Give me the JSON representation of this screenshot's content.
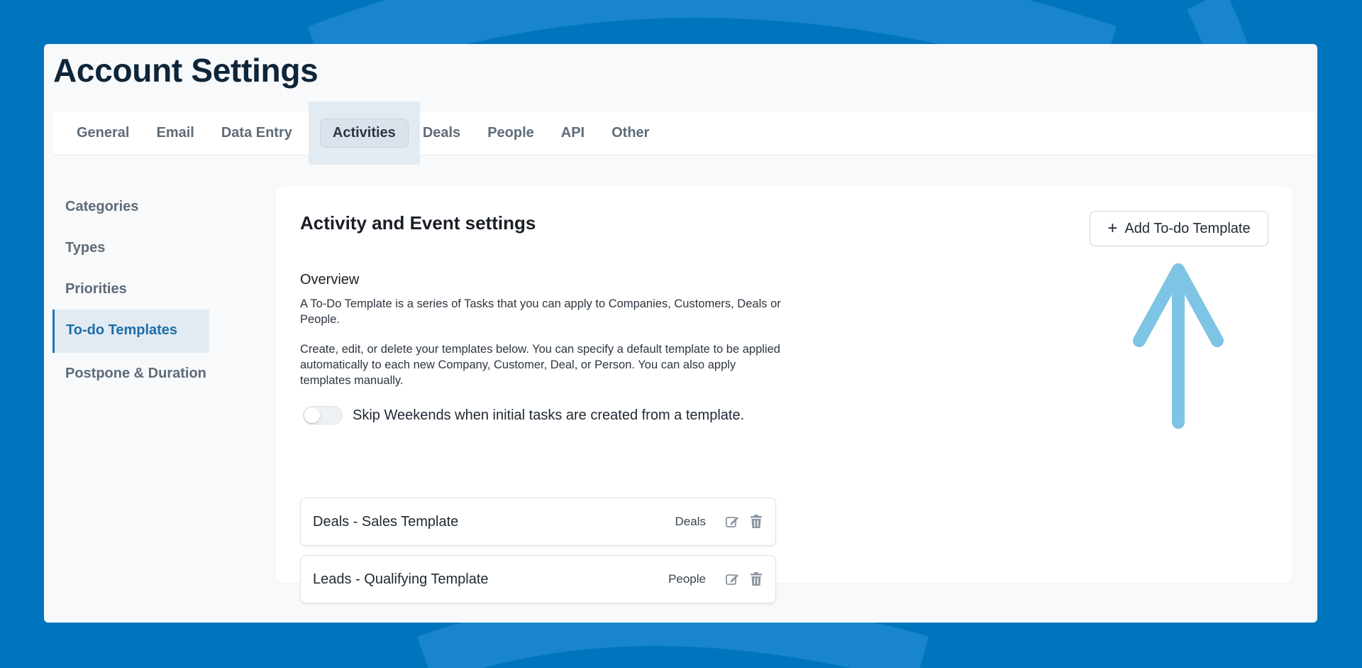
{
  "page": {
    "title": "Account Settings"
  },
  "tabs": [
    {
      "label": "General"
    },
    {
      "label": "Email"
    },
    {
      "label": "Data Entry"
    },
    {
      "label": "Activities",
      "active": true
    },
    {
      "label": "Deals"
    },
    {
      "label": "People"
    },
    {
      "label": "API"
    },
    {
      "label": "Other"
    }
  ],
  "sidebar": {
    "items": [
      {
        "label": "Categories"
      },
      {
        "label": "Types"
      },
      {
        "label": "Priorities"
      },
      {
        "label": "To-do Templates",
        "active": true
      },
      {
        "label": "Postpone & Duration"
      }
    ]
  },
  "main": {
    "title": "Activity and Event settings",
    "add_button": {
      "label": "Add To-do Template",
      "icon": "plus-icon"
    },
    "overview_heading": "Overview",
    "paragraph1": "A To-Do Template is a series of Tasks that you can apply to Companies, Customers, Deals or People.",
    "paragraph2": "Create, edit, or delete your templates below. You can specify a default template to be applied automatically to each new Company, Customer, Deal, or Person. You can also apply templates manually.",
    "toggle": {
      "label": "Skip Weekends when initial tasks are created from a template.",
      "on": false
    },
    "templates": [
      {
        "name": "Deals - Sales Template",
        "type": "Deals"
      },
      {
        "name": "Leads - Qualifying Template",
        "type": "People"
      }
    ]
  },
  "colors": {
    "background": "#0075bd",
    "accent": "#1b6ea9",
    "arrow": "#7ec4e4"
  }
}
